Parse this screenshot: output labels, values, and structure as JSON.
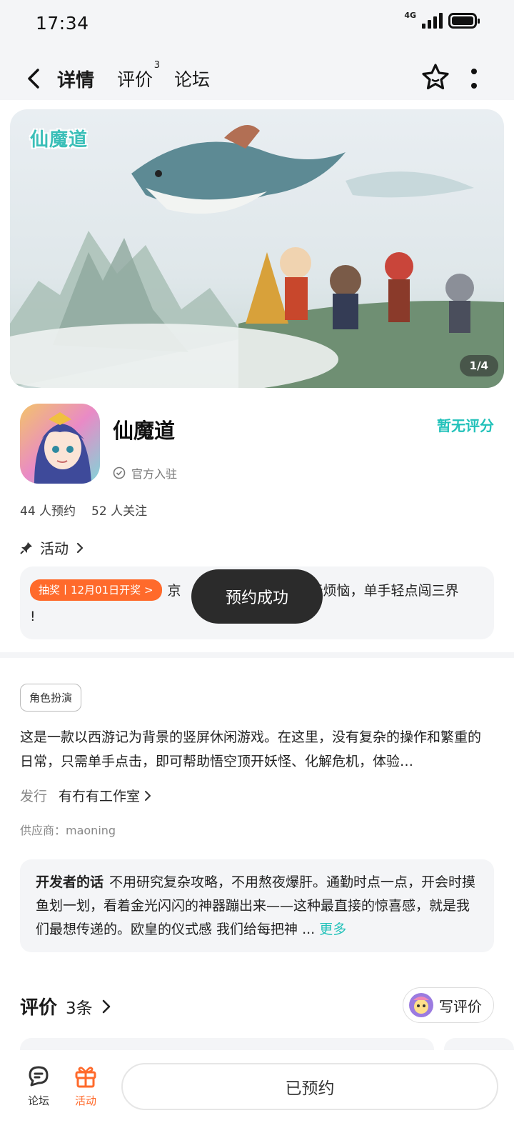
{
  "status_bar": {
    "time": "17:34",
    "network": "4G"
  },
  "nav": {
    "tabs": [
      {
        "label": "详情",
        "active": true
      },
      {
        "label": "评价",
        "badge": "3"
      },
      {
        "label": "论坛"
      }
    ],
    "back_icon": "chevron-left-icon",
    "favorite_icon": "star-icon",
    "more_icon": "more-vertical-icon"
  },
  "banner": {
    "logo_text": "仙魔道",
    "counter": "1/4"
  },
  "app": {
    "name": "仙魔道",
    "official_label": "官方入驻",
    "rating_text": "暂无评分",
    "reservations": "44 人预约",
    "follows": "52 人关注"
  },
  "activity": {
    "header": "活动",
    "tag": "抽奖丨12月01日开奖 >",
    "text_before": "京",
    "text_after": "无烦恼，单手轻点闯三界",
    "text_line2": "!"
  },
  "toast": "预约成功",
  "details": {
    "genre": "角色扮演",
    "description": "这是一款以西游记为背景的竖屏休闲游戏。在这里，没有复杂的操作和繁重的日常，只需单手点击，即可帮助悟空顶开妖怪、化解危机，体验…",
    "publisher_label": "发行",
    "publisher_name": "有冇有工作室",
    "supplier": "供应商：maoning"
  },
  "developer_note": {
    "label": "开发者的话",
    "text": "不用研究复杂攻略，不用熬夜爆肝。通勤时点一点，开会时摸鱼划一划，看着金光闪闪的神器蹦出来——这种最直接的惊喜感，就是我们最想传递的。欧皇的仪式感 我们给每把神 ...",
    "more": "更多"
  },
  "reviews": {
    "title": "评价",
    "count": "3条",
    "write_label": "写评价"
  },
  "bottom_bar": {
    "forum_label": "论坛",
    "activity_label": "活动",
    "reserved_label": "已预约"
  },
  "colors": {
    "accent": "#23c2ba",
    "orange": "#ff6a2b",
    "toast_bg": "#2b2b2b",
    "card_bg": "#f4f5f7"
  }
}
